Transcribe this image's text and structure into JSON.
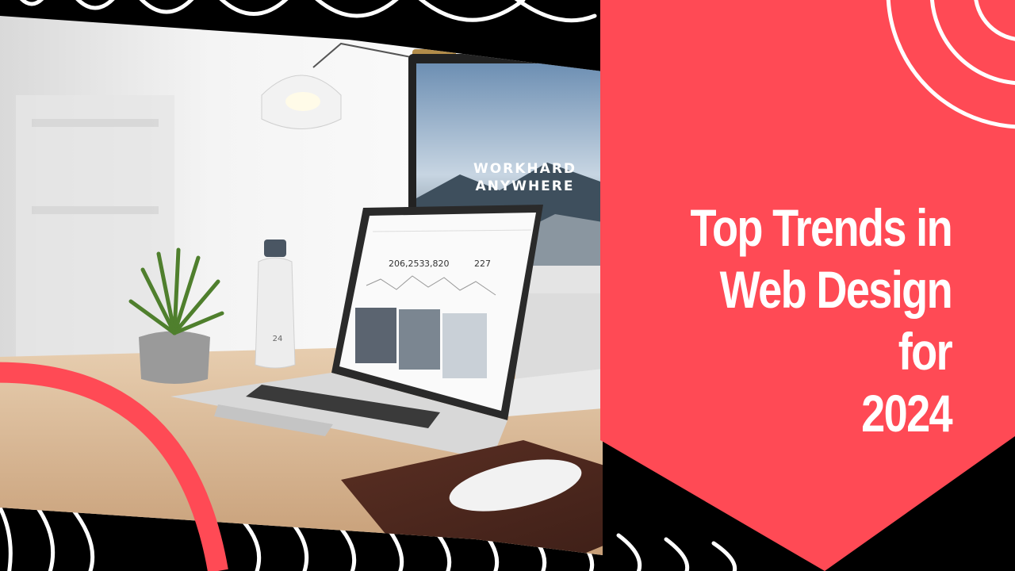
{
  "banner": {
    "title": "Top Trends in\nWeb Design for\n2024",
    "accent_color": "#ff4a55",
    "background_color": "#000000"
  },
  "photo": {
    "monitor_screen": {
      "headline_line1": "WORKHARD",
      "headline_line2": "ANYWHERE"
    },
    "laptop_screen": {
      "stats": [
        {
          "value": "206,253"
        },
        {
          "value": "3,820"
        },
        {
          "value": "227"
        }
      ]
    },
    "bottle_label": "24"
  }
}
